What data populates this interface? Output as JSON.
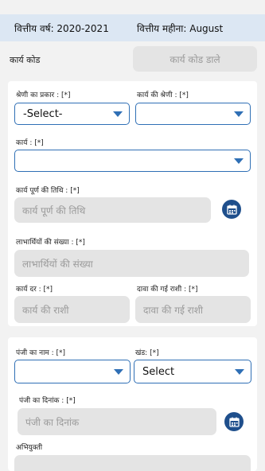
{
  "header": {
    "financial_year": "वित्तीय वर्ष: 2020-2021",
    "financial_month": "वित्तीय महीना: August"
  },
  "work_code": {
    "label": "कार्य कोड",
    "placeholder": "कार्य कोड डाले"
  },
  "form1": {
    "category_type_label": "श्रेणी का प्रकार : [*]",
    "category_type_value": "-Select-",
    "work_category_label": "कार्य की श्रेणी : [*]",
    "work_category_value": "",
    "work_label": "कार्य : [*]",
    "work_value": "",
    "completion_date_label": "कार्य पूर्ण की तिथि : [*]",
    "completion_date_placeholder": "कार्य पूर्ण की तिथि",
    "beneficiaries_label": "लाभार्थियों की संख्या : [*]",
    "beneficiaries_placeholder": "लाभार्थियों की संख्या",
    "work_rate_label": "कार्य दर : [*]",
    "work_rate_placeholder": "कार्य की राशी",
    "claimed_amount_label": "दावा की गई राशी : [*]",
    "claimed_amount_placeholder": "दावा की गई राशी"
  },
  "form2": {
    "register_name_label": "पंजी का नाम : [*]",
    "register_name_value": "",
    "volume_label": "खंड: [*]",
    "volume_value": "Select",
    "register_date_label": "पंजी का दिनांक : [*]",
    "register_date_placeholder": "पंजी का दिनांक",
    "remarks_label": "अभियुक्ती"
  },
  "colors": {
    "accent": "#2f6fb5",
    "calendar_button": "#1f4f8c",
    "header_bg": "#dce7f3"
  }
}
